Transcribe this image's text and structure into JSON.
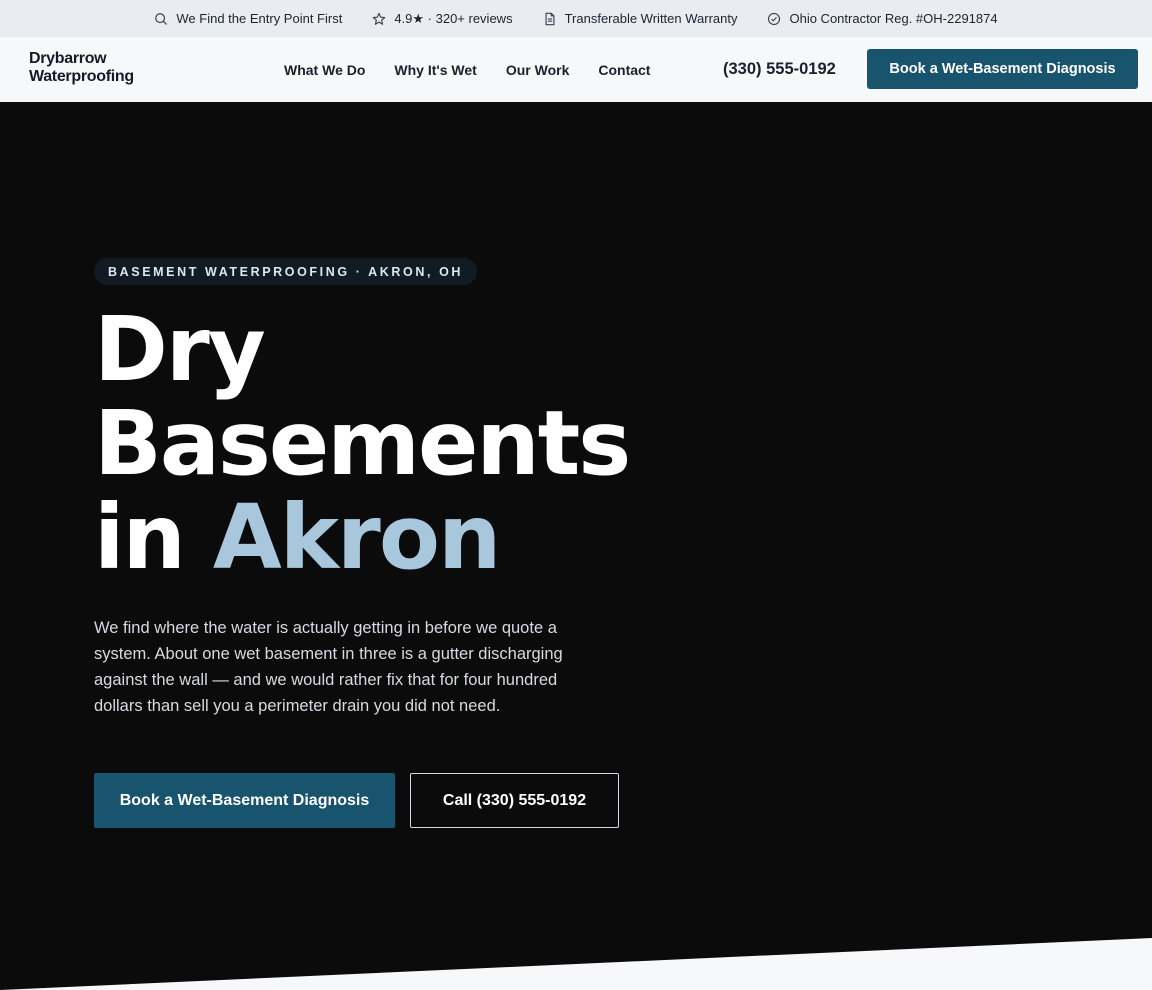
{
  "trust_bar": {
    "items": [
      {
        "icon": "search-icon",
        "label": "We Find the Entry Point First"
      },
      {
        "icon": "star-icon",
        "label": "4.9★ · 320+ reviews"
      },
      {
        "icon": "document-icon",
        "label": "Transferable Written Warranty"
      },
      {
        "icon": "check-circle-icon",
        "label": "Ohio Contractor Reg. #OH-2291874"
      }
    ]
  },
  "header": {
    "logo_line1": "Drybarrow",
    "logo_line2": "Waterproofing",
    "nav": [
      "What We Do",
      "Why It's Wet",
      "Our Work",
      "Contact"
    ],
    "phone": "(330) 555-0192",
    "cta": "Book a Wet-Basement Diagnosis"
  },
  "hero": {
    "eyebrow": "BASEMENT WATERPROOFING · AKRON, OH",
    "headline_line1": "Dry",
    "headline_line2": "Basements",
    "headline_line3_prefix": "in ",
    "headline_accent": "Akron",
    "lede": "We find where the water is actually getting in before we quote a system. About one wet basement in three is a gutter discharging against the wall — and we would rather fix that for four hundred dollars than sell you a perimeter drain you did not need.",
    "primary_cta": "Book a Wet-Basement Diagnosis",
    "secondary_cta": "Call (330) 555-0192"
  },
  "colors": {
    "brand": "#19546e",
    "accent_text": "#a9c7dc",
    "hero_bg": "#0b0b0c",
    "topbar_bg": "#e9ecf1",
    "header_bg": "#f7f8fa"
  }
}
